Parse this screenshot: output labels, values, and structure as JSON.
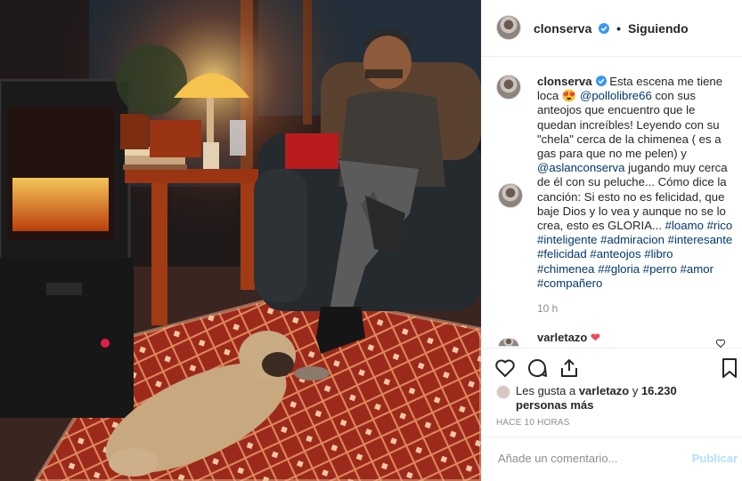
{
  "post": {
    "username": "clonserva",
    "follow_status": "Siguiendo",
    "caption_username": "clonserva",
    "caption_parts": [
      {
        "t": "text",
        "v": " Esta escena me tiene loca 😍 "
      },
      {
        "t": "mention",
        "v": "@pollolibre66"
      },
      {
        "t": "text",
        "v": " con sus anteojos que encuentro que le quedan increíbles! Leyendo con su \"chela\" cerca de la chimenea ( es a gas para que no me pelen) y "
      },
      {
        "t": "mention",
        "v": "@aslanconserva"
      },
      {
        "t": "text",
        "v": " jugando muy cerca de él con su peluche... Cómo dice la canción: Si esto no es felicidad, que baje Dios y lo vea y aunque no se lo crea, esto es GLORIA... "
      },
      {
        "t": "tag",
        "v": "#loamo"
      },
      {
        "t": "text",
        "v": " "
      },
      {
        "t": "tag",
        "v": "#rico"
      },
      {
        "t": "text",
        "v": " "
      },
      {
        "t": "tag",
        "v": "#inteligente"
      },
      {
        "t": "text",
        "v": " "
      },
      {
        "t": "tag",
        "v": "#admiracion"
      },
      {
        "t": "text",
        "v": " "
      },
      {
        "t": "tag",
        "v": "#interesante"
      },
      {
        "t": "text",
        "v": " "
      },
      {
        "t": "tag",
        "v": "#felicidad"
      },
      {
        "t": "text",
        "v": " "
      },
      {
        "t": "tag",
        "v": "#anteojos"
      },
      {
        "t": "text",
        "v": " "
      },
      {
        "t": "tag",
        "v": "#libro"
      },
      {
        "t": "text",
        "v": " "
      },
      {
        "t": "tag",
        "v": "#chimenea"
      },
      {
        "t": "text",
        "v": " "
      },
      {
        "t": "tag",
        "v": "##gloria"
      },
      {
        "t": "text",
        "v": " "
      },
      {
        "t": "tag",
        "v": "#perro"
      },
      {
        "t": "text",
        "v": " "
      },
      {
        "t": "tag",
        "v": "#amor"
      },
      {
        "t": "text",
        "v": " "
      },
      {
        "t": "tag",
        "v": "#compañero"
      }
    ],
    "caption_time": "10 h",
    "next_comment_user": "varletazo",
    "likes_prefix": "Les gusta a ",
    "likes_user": "varletazo",
    "likes_mid": " y ",
    "likes_count": "16.230 personas más",
    "posted_ago": "HACE 10 HORAS",
    "comment_placeholder": "Añade un comentario...",
    "publish_label": "Publicar"
  },
  "icons": {
    "verified": "verified-badge-icon",
    "like": "heart-icon",
    "comment": "comment-icon",
    "share": "share-icon",
    "save": "bookmark-icon"
  },
  "colors": {
    "link": "#00376b",
    "verified": "#3897f0",
    "publish_disabled": "#b2dffc",
    "heart": "#ed4956"
  }
}
